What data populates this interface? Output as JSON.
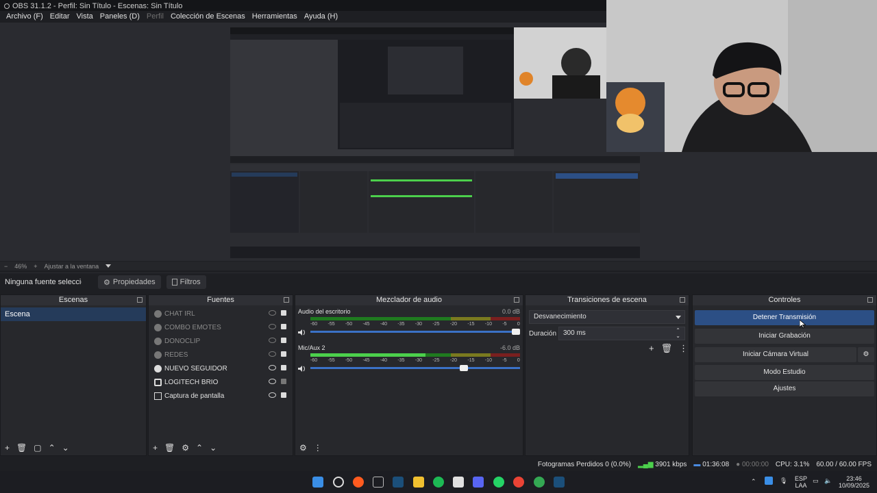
{
  "window": {
    "title": "OBS 31.1.2 - Perfil: Sin Título - Escenas: Sin Título"
  },
  "menu": [
    {
      "label": "Archivo (F)",
      "dim": false
    },
    {
      "label": "Editar",
      "dim": false
    },
    {
      "label": "Vista",
      "dim": false
    },
    {
      "label": "Paneles (D)",
      "dim": false
    },
    {
      "label": "Perfil",
      "dim": true
    },
    {
      "label": "Colección de Escenas",
      "dim": false
    },
    {
      "label": "Herramientas",
      "dim": false
    },
    {
      "label": "Ayuda (H)",
      "dim": false
    }
  ],
  "zoom": {
    "minus": "−",
    "value": "46%",
    "plus": "+",
    "fit": "Ajustar a la ventana"
  },
  "source_bar": {
    "no_selection": "Ninguna fuente seleccionada",
    "properties": "Propiedades",
    "filters": "Filtros"
  },
  "scenes": {
    "title": "Escenas",
    "items": [
      "Escena"
    ]
  },
  "sources": {
    "title": "Fuentes",
    "items": [
      {
        "name": "CHAT IRL",
        "visible": false,
        "dim": true
      },
      {
        "name": "COMBO EMOTES",
        "visible": false,
        "dim": true
      },
      {
        "name": "DONOCLIP",
        "visible": false,
        "dim": true
      },
      {
        "name": "REDES",
        "visible": false,
        "dim": true
      },
      {
        "name": "NUEVO SEGUIDOR",
        "visible": true,
        "dim": false
      },
      {
        "name": "LOGITECH BRIO",
        "visible": true,
        "dim": false
      },
      {
        "name": "Captura de pantalla",
        "visible": true,
        "dim": false
      }
    ]
  },
  "mixer": {
    "title": "Mezclador de audio",
    "ticks": [
      "-60",
      "-55",
      "-50",
      "-45",
      "-40",
      "-35",
      "-30",
      "-25",
      "-20",
      "-15",
      "-10",
      "-5",
      "0"
    ],
    "channels": [
      {
        "name": "Audio del escritorio",
        "db": "0.0 dB",
        "level": 0,
        "volume": 1.0
      },
      {
        "name": "Mic/Aux 2",
        "db": "-6.0 dB",
        "level": 0.55,
        "volume": 0.75
      }
    ]
  },
  "transitions": {
    "title": "Transiciones de escena",
    "selected": "Desvanecimiento",
    "duration_label": "Duración",
    "duration_value": "300 ms"
  },
  "controls": {
    "title": "Controles",
    "stop_stream": "Detener Transmisión",
    "start_recording": "Iniciar Grabación",
    "start_virtual_cam": "Iniciar Cámara Virtual",
    "studio_mode": "Modo Estudio",
    "settings": "Ajustes"
  },
  "status": {
    "dropped": "Fotogramas Perdidos 0 (0.0%)",
    "bitrate": "3901 kbps",
    "stream_time": "01:36:08",
    "rec_time": "00:00:00",
    "cpu": "CPU: 3.1%",
    "fps": "60.00 / 60.00 FPS"
  },
  "tray": {
    "lang_1": "ESP",
    "lang_2": "LAA",
    "time": "23:46",
    "date": "10/09/2025"
  },
  "colors": {
    "accent": "#2c4f85",
    "meter_green": "#4cd04c",
    "bg": "#1e1f23"
  }
}
